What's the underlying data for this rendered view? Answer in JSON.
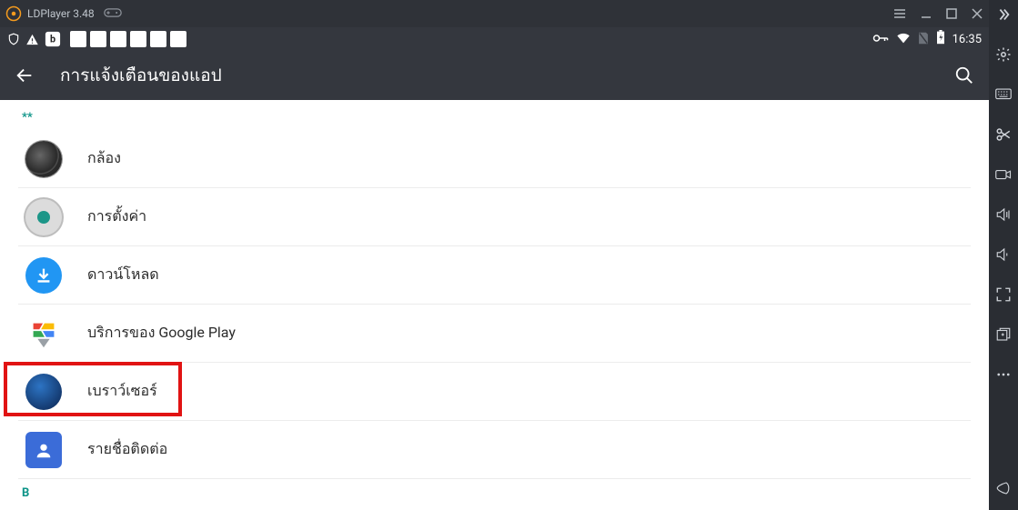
{
  "titlebar": {
    "app_name": "LDPlayer 3.48"
  },
  "statusbar": {
    "time": "16:35"
  },
  "header": {
    "title": "การแจ้งเตือนของแอป"
  },
  "sections": {
    "s1": {
      "header": "**"
    },
    "s2": {
      "header": "B"
    }
  },
  "apps": {
    "camera": {
      "label": "กล้อง"
    },
    "settings": {
      "label": "การตั้งค่า"
    },
    "download": {
      "label": "ดาวน์โหลด"
    },
    "play": {
      "label": "บริการของ Google Play"
    },
    "browser": {
      "label": "เบราว์เซอร์"
    },
    "contacts": {
      "label": "รายชื่อติดต่อ"
    }
  }
}
